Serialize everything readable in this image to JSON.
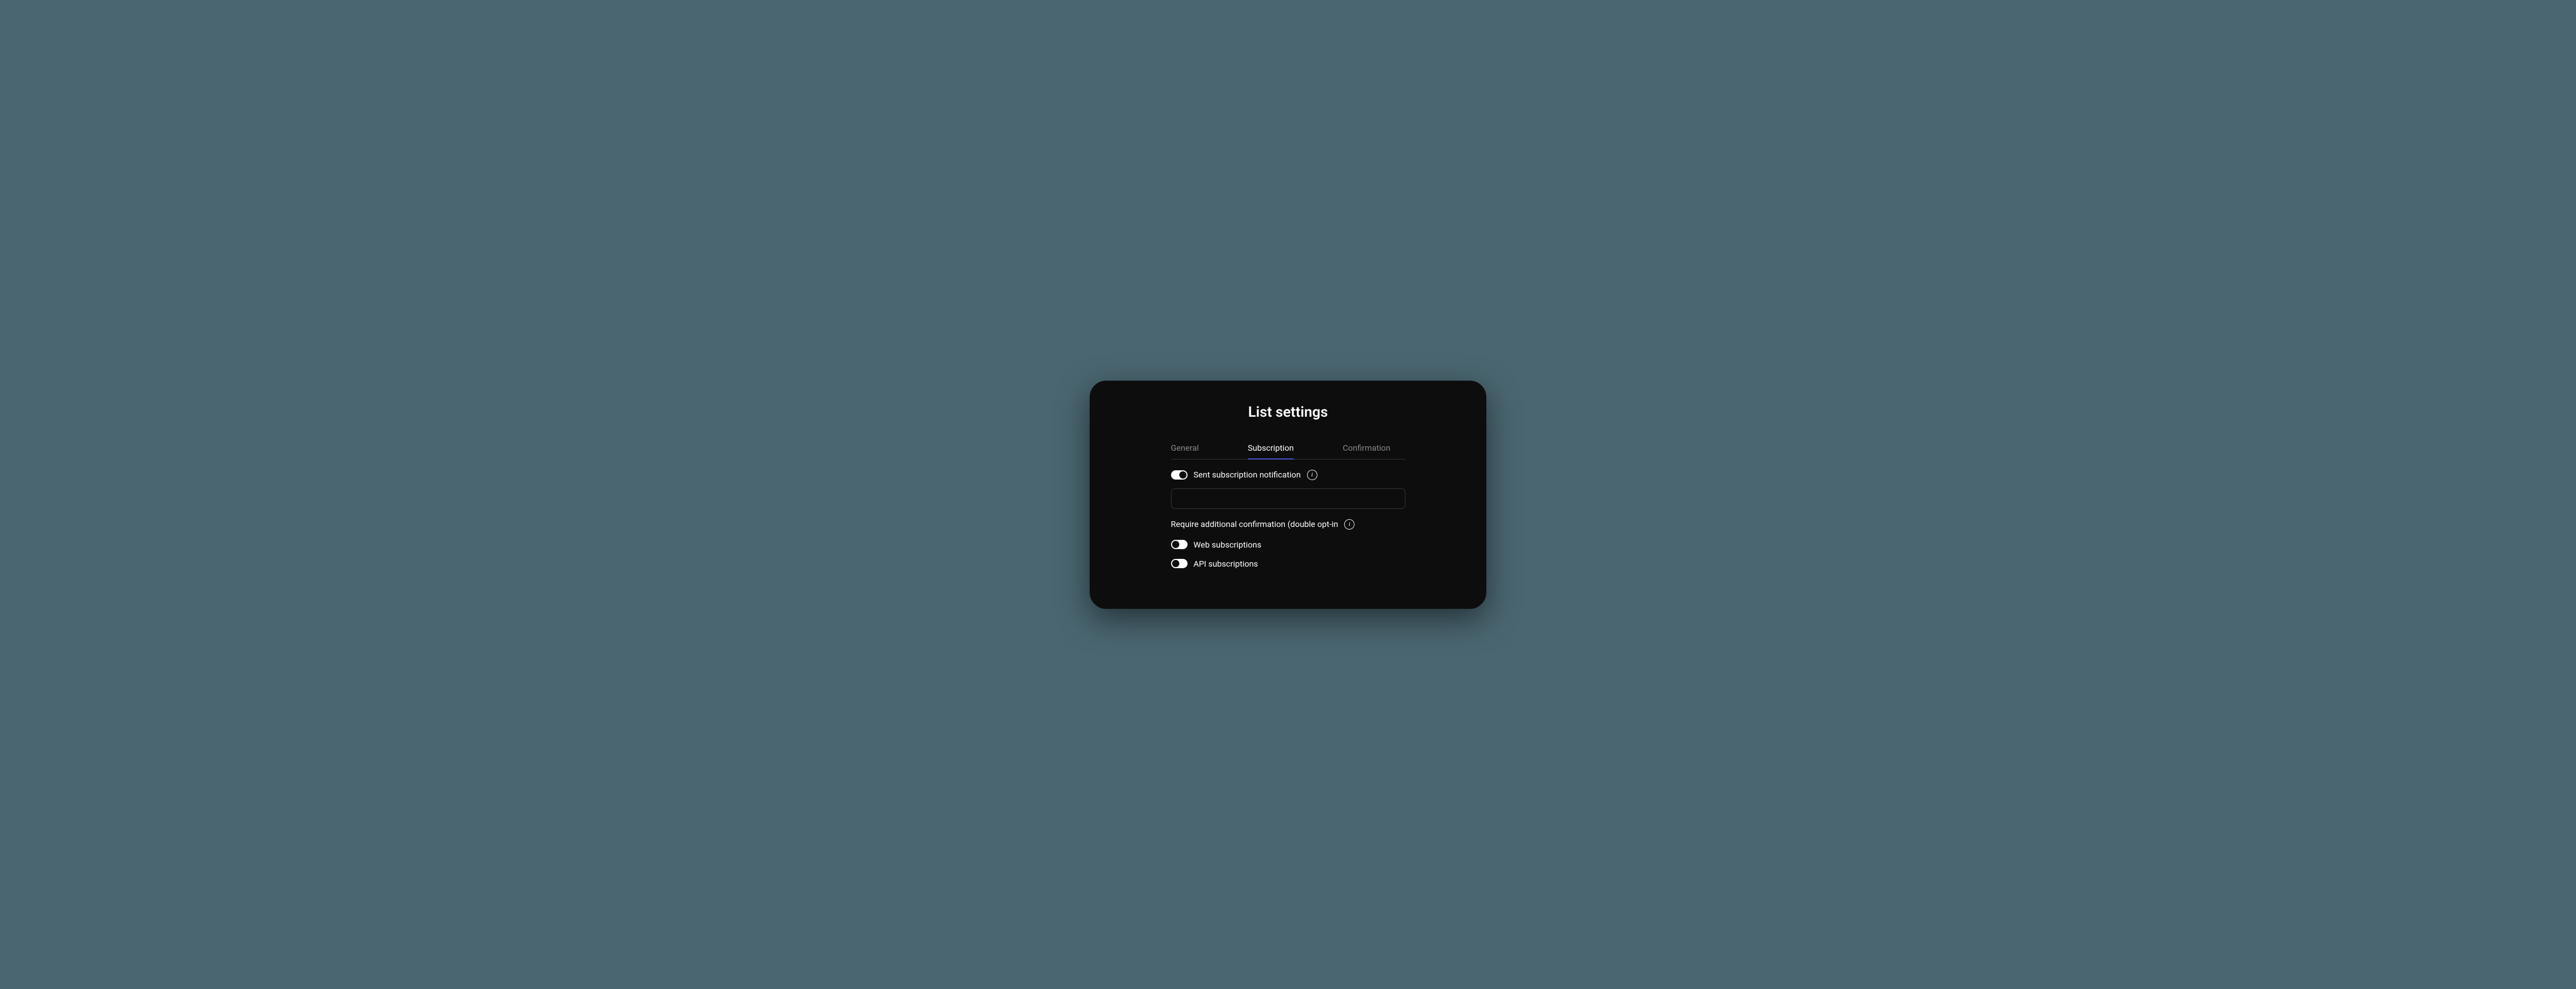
{
  "title": "List settings",
  "tabs": [
    {
      "label": "General",
      "active": false
    },
    {
      "label": "Subscription",
      "active": true
    },
    {
      "label": "Confirmation",
      "active": false
    }
  ],
  "settings": {
    "notification": {
      "label": "Sent subscription notification",
      "toggle_on": true
    },
    "notification_input": {
      "value": ""
    },
    "double_optin": {
      "label": "Require additional confirmation (double opt-in"
    },
    "web_subscriptions": {
      "label": "Web subscriptions",
      "toggle_on": false
    },
    "api_subscriptions": {
      "label": "API subscriptions",
      "toggle_on": false
    }
  },
  "icons": {
    "info": "i"
  }
}
